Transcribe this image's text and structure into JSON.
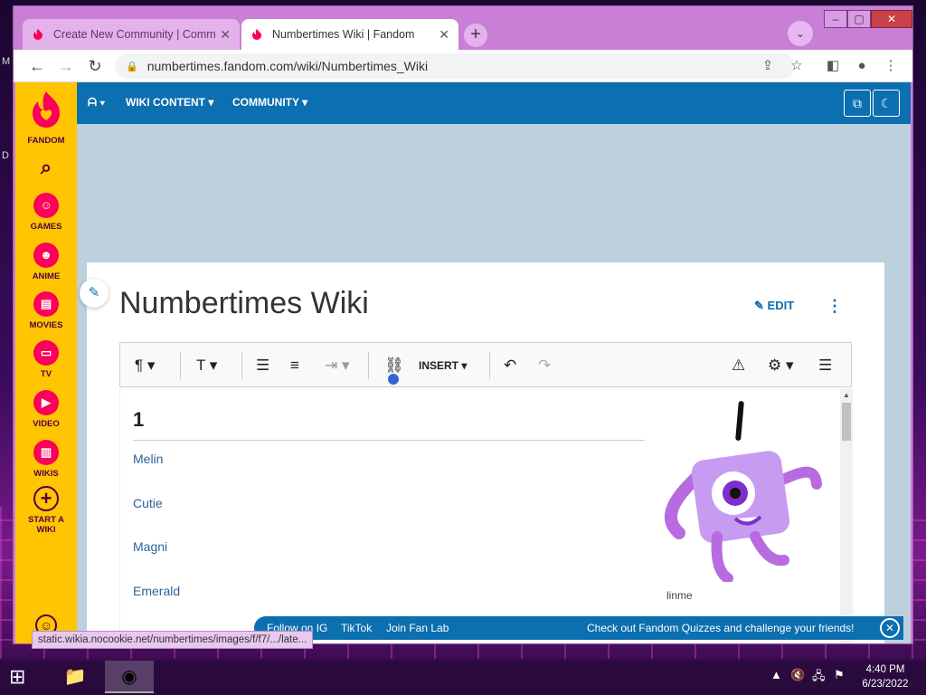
{
  "browser": {
    "tabs": [
      {
        "title": "Create New Community | Comm",
        "active": false
      },
      {
        "title": "Numbertimes Wiki | Fandom",
        "active": true
      }
    ],
    "new_tab_symbol": "+",
    "url": "numbertimes.fandom.com/wiki/Numbertimes_Wiki",
    "status_url": "static.wikia.nocookie.net/numbertimes/images/f/f7/.../late..."
  },
  "fandom_rail": {
    "logo_label": "FANDOM",
    "items": [
      {
        "label": "GAMES",
        "icon": "gamepad-icon"
      },
      {
        "label": "ANIME",
        "icon": "anime-icon"
      },
      {
        "label": "MOVIES",
        "icon": "clapper-icon"
      },
      {
        "label": "TV",
        "icon": "tv-icon"
      },
      {
        "label": "VIDEO",
        "icon": "play-icon"
      },
      {
        "label": "WIKIS",
        "icon": "book-icon"
      },
      {
        "label": "START A WIKI",
        "icon": "plus-circle-icon"
      }
    ]
  },
  "wiki_nav": {
    "items": [
      "WIKI CONTENT",
      "COMMUNITY"
    ]
  },
  "article": {
    "title": "Numbertimes Wiki",
    "edit_label": "EDIT",
    "insert_label": "INSERT",
    "heading": "1",
    "links": [
      "Melin",
      "Cutie",
      "Magni",
      "Emerald"
    ],
    "image_caption": "linme"
  },
  "bottom_bar": {
    "links": [
      "Follow on IG",
      "TikTok",
      "Join Fan Lab"
    ],
    "promo": "Check out Fandom Quizzes and challenge your friends!"
  },
  "taskbar": {
    "time": "4:40 PM",
    "date": "6/23/2022"
  },
  "colors": {
    "fandom_yellow": "#ffc500",
    "fandom_pink": "#fa005a",
    "wiki_blue": "#0c6fb0",
    "tabstrip": "#c97fd6"
  }
}
